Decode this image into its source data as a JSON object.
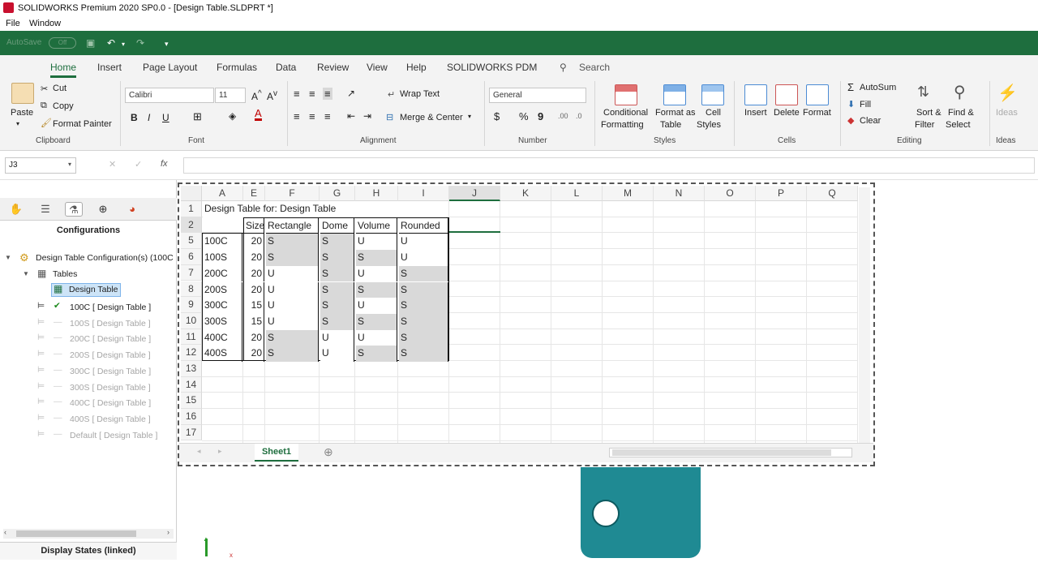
{
  "window": {
    "title": "SOLIDWORKS Premium 2020 SP0.0 - [Design Table.SLDPRT *]"
  },
  "menu": [
    "File",
    "Window"
  ],
  "qat": {
    "autosave": "AutoSave",
    "toggle": "Off"
  },
  "ribbon_tabs": [
    "Home",
    "Insert",
    "Page Layout",
    "Formulas",
    "Data",
    "Review",
    "View",
    "Help",
    "SOLIDWORKS PDM"
  ],
  "search_placeholder": "Search",
  "clipboard": {
    "paste": "Paste",
    "cut": "Cut",
    "copy": "Copy",
    "format_painter": "Format Painter",
    "label": "Clipboard"
  },
  "font": {
    "name": "Calibri",
    "size": "11",
    "label": "Font",
    "bold": "B",
    "italic": "I",
    "underline": "U"
  },
  "alignment": {
    "wrap": "Wrap Text",
    "merge": "Merge & Center",
    "label": "Alignment"
  },
  "number": {
    "format": "General",
    "label": "Number"
  },
  "styles": {
    "conditional": "Conditional",
    "conditional2": "Formatting",
    "format_as": "Format as",
    "format_as2": "Table",
    "cell": "Cell",
    "cell2": "Styles",
    "label": "Styles"
  },
  "cells": {
    "insert": "Insert",
    "delete": "Delete",
    "format": "Format",
    "label": "Cells"
  },
  "editing": {
    "autosum": "AutoSum",
    "fill": "Fill",
    "clear": "Clear",
    "sort": "Sort &",
    "sort2": "Filter",
    "find": "Find &",
    "find2": "Select",
    "label": "Editing"
  },
  "ideas": {
    "label": "Ideas",
    "btn": "Ideas"
  },
  "namebox": "J3",
  "panel": {
    "title": "Configurations",
    "root": "Design Table Configuration(s)  (100C",
    "tables": "Tables",
    "design_table": "Design Table",
    "configs": [
      {
        "label": "100C [ Design Table ]",
        "active": true
      },
      {
        "label": "100S [ Design Table ]",
        "active": false
      },
      {
        "label": "200C [ Design Table ]",
        "active": false
      },
      {
        "label": "200S [ Design Table ]",
        "active": false
      },
      {
        "label": "300C [ Design Table ]",
        "active": false
      },
      {
        "label": "300S [ Design Table ]",
        "active": false
      },
      {
        "label": "400C [ Design Table ]",
        "active": false
      },
      {
        "label": "400S [ Design Table ]",
        "active": false
      },
      {
        "label": "Default [ Design Table ]",
        "active": false
      }
    ],
    "display_states": "Display States (linked)"
  },
  "sheet": {
    "columns": [
      "A",
      "E",
      "F",
      "G",
      "H",
      "I",
      "J",
      "K",
      "L",
      "M",
      "N",
      "O",
      "P",
      "Q"
    ],
    "row_numbers": [
      "1",
      "2",
      "5",
      "6",
      "7",
      "8",
      "9",
      "10",
      "11",
      "12",
      "13",
      "14",
      "15",
      "16",
      "17"
    ],
    "title_cell": "Design Table for: Design Table",
    "headers": [
      "",
      "Size",
      "Rectangle",
      "Dome",
      "Volume",
      "Rounded"
    ],
    "rows": [
      [
        "100C",
        "20",
        "S",
        "S",
        "U",
        "U"
      ],
      [
        "100S",
        "20",
        "S",
        "S",
        "S",
        "U"
      ],
      [
        "200C",
        "20",
        "U",
        "S",
        "U",
        "S"
      ],
      [
        "200S",
        "20",
        "U",
        "S",
        "S",
        "S"
      ],
      [
        "300C",
        "15",
        "U",
        "S",
        "U",
        "S"
      ],
      [
        "300S",
        "15",
        "U",
        "S",
        "S",
        "S"
      ],
      [
        "400C",
        "20",
        "S",
        "U",
        "U",
        "S"
      ],
      [
        "400S",
        "20",
        "S",
        "U",
        "S",
        "S"
      ]
    ],
    "tab": "Sheet1"
  },
  "colors": {
    "accent": "#1e6e3e",
    "part": "#1f8a93"
  }
}
